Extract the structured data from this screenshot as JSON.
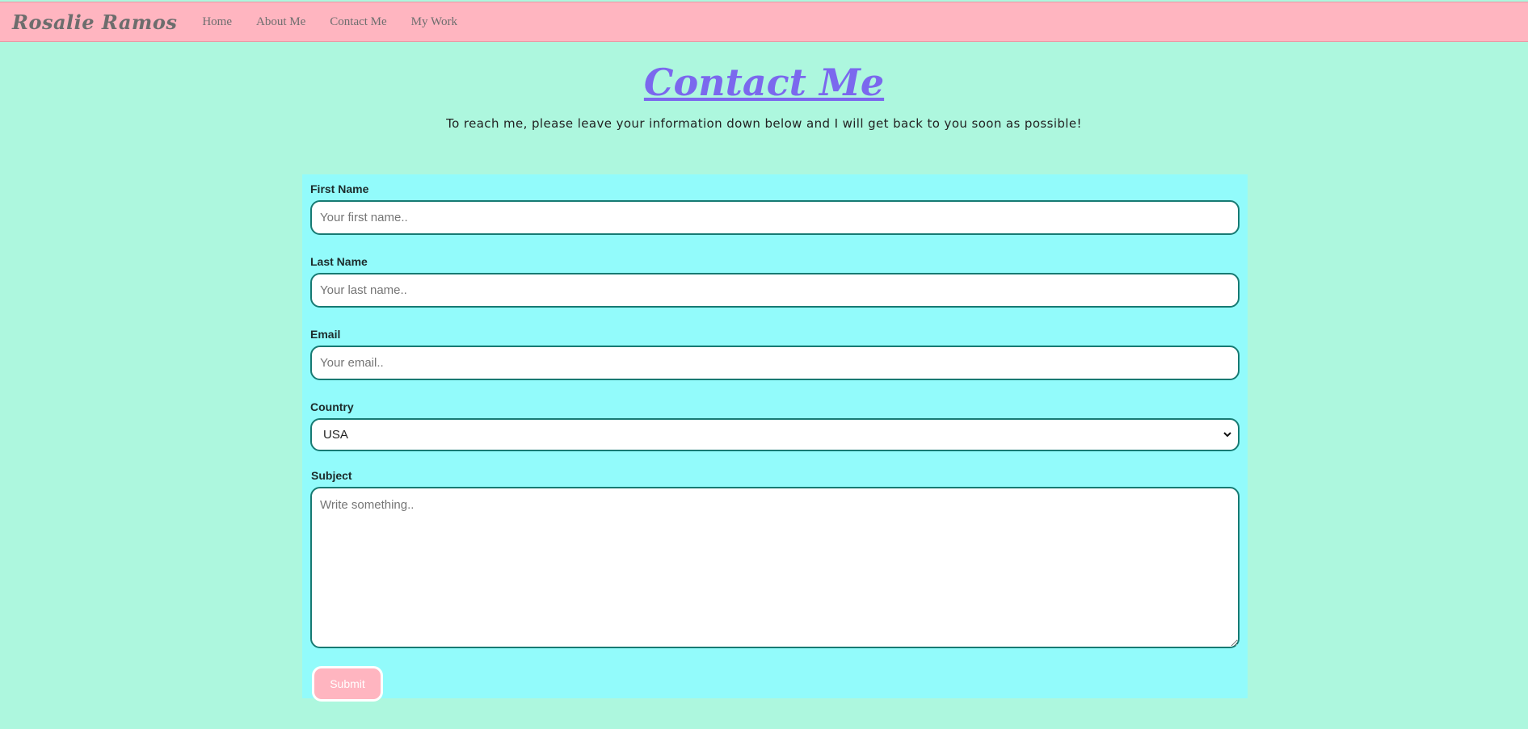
{
  "nav": {
    "brand": "Rosalie Ramos",
    "links": [
      "Home",
      "About Me",
      "Contact Me",
      "My Work"
    ]
  },
  "header": {
    "title": "Contact Me",
    "subtitle": "To reach me, please leave your information down below and I will get back to you soon as possible!"
  },
  "form": {
    "first_name": {
      "label": "First Name",
      "placeholder": "Your first name.."
    },
    "last_name": {
      "label": "Last Name",
      "placeholder": "Your last name.."
    },
    "email": {
      "label": "Email",
      "placeholder": "Your email.."
    },
    "country": {
      "label": "Country",
      "value": "USA"
    },
    "subject": {
      "label": "Subject",
      "placeholder": "Write something.."
    },
    "submit_label": "Submit"
  },
  "colors": {
    "background": "#adf7de",
    "navbar": "#ffb5c0",
    "form_panel": "#92fbfb",
    "title": "#7b68ee",
    "input_border": "#177a73",
    "submit": "#ffb5c0"
  },
  "icons": {
    "country_select": "chevron-down-icon"
  }
}
